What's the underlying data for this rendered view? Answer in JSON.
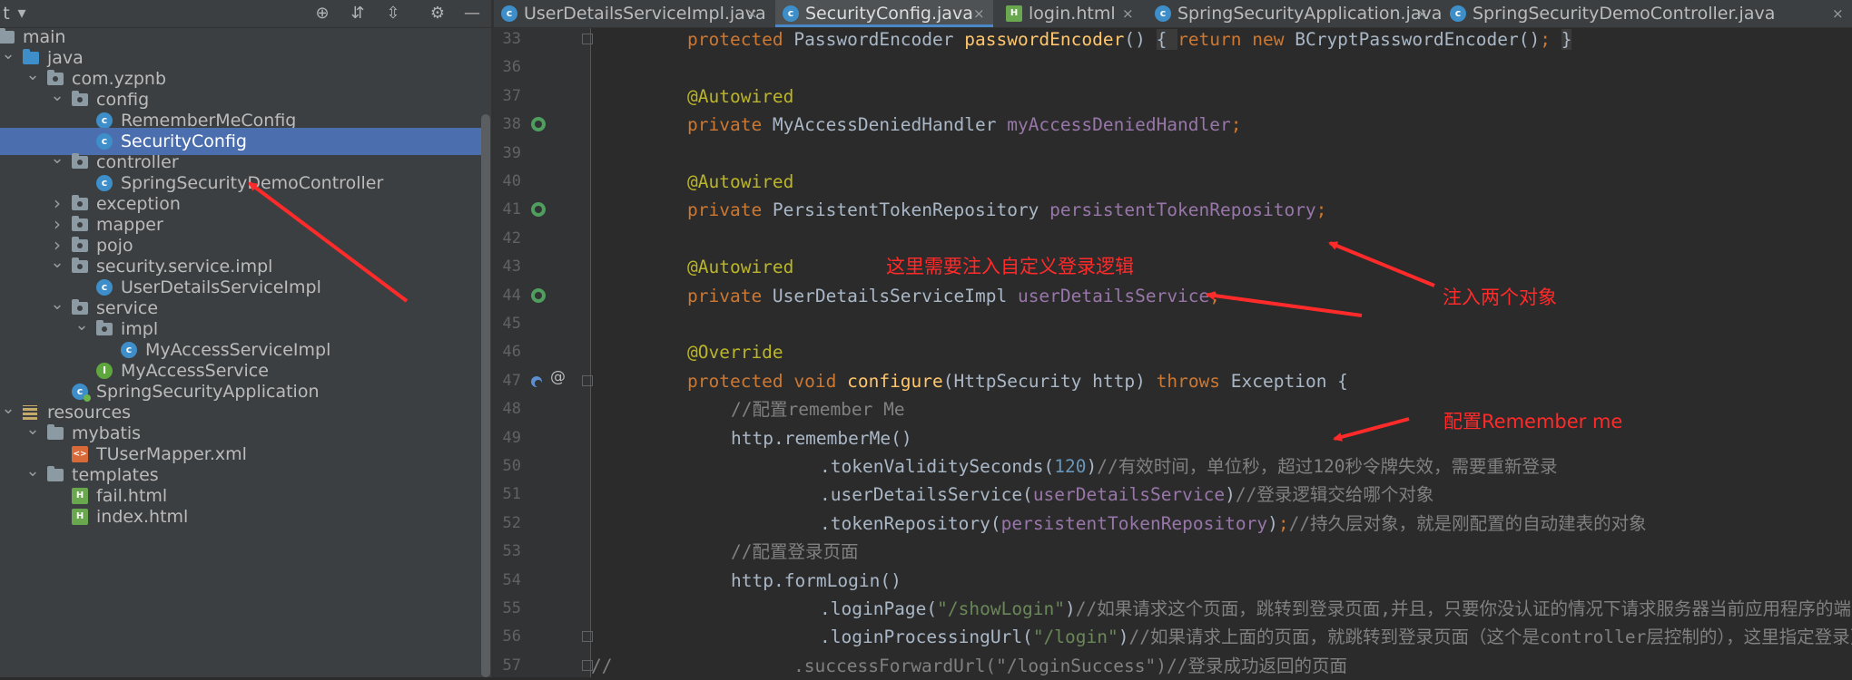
{
  "sidebar": {
    "items": [
      {
        "label": "main",
        "arrow": "open",
        "icon": "folder"
      },
      {
        "label": "java",
        "arrow": "open",
        "icon": "folder-blue"
      },
      {
        "label": "com.yzpnb",
        "arrow": "open",
        "icon": "package"
      },
      {
        "label": "config",
        "arrow": "open",
        "icon": "package"
      },
      {
        "label": "RememberMeConfig",
        "arrow": "",
        "icon": "class"
      },
      {
        "label": "SecurityConfig",
        "arrow": "",
        "icon": "class",
        "selected": true
      },
      {
        "label": "controller",
        "arrow": "open",
        "icon": "package"
      },
      {
        "label": "SpringSecurityDemoController",
        "arrow": "",
        "icon": "class"
      },
      {
        "label": "exception",
        "arrow": "closed",
        "icon": "package"
      },
      {
        "label": "mapper",
        "arrow": "closed",
        "icon": "package"
      },
      {
        "label": "pojo",
        "arrow": "closed",
        "icon": "package"
      },
      {
        "label": "security.service.impl",
        "arrow": "open",
        "icon": "package"
      },
      {
        "label": "UserDetailsServiceImpl",
        "arrow": "",
        "icon": "class"
      },
      {
        "label": "service",
        "arrow": "open",
        "icon": "package"
      },
      {
        "label": "impl",
        "arrow": "open",
        "icon": "package"
      },
      {
        "label": "MyAccessServiceImpl",
        "arrow": "",
        "icon": "class"
      },
      {
        "label": "MyAccessService",
        "arrow": "",
        "icon": "interface"
      },
      {
        "label": "SpringSecurityApplication",
        "arrow": "",
        "icon": "app-class"
      },
      {
        "label": "resources",
        "arrow": "open",
        "icon": "resources-folder"
      },
      {
        "label": "mybatis",
        "arrow": "open",
        "icon": "folder"
      },
      {
        "label": "TUserMapper.xml",
        "arrow": "",
        "icon": "xml-file"
      },
      {
        "label": "templates",
        "arrow": "open",
        "icon": "folder"
      },
      {
        "label": "fail.html",
        "arrow": "",
        "icon": "html-file"
      },
      {
        "label": "index.html",
        "arrow": "",
        "icon": "html-file"
      }
    ],
    "toolbar_glyphs": {
      "target": "⊕",
      "expand": "⇵",
      "collapse": "⇳",
      "settings": "⚙",
      "hide": "—",
      "dropdown": "▾",
      "t": "t"
    }
  },
  "tabs": [
    {
      "label": "UserDetailsServiceImpl.java",
      "icon": "C",
      "kind": "class"
    },
    {
      "label": "SecurityConfig.java",
      "icon": "C",
      "kind": "class",
      "active": true
    },
    {
      "label": "login.html",
      "icon": "H",
      "kind": "html"
    },
    {
      "label": "SpringSecurityApplication.java",
      "icon": "C",
      "kind": "class"
    },
    {
      "label": "SpringSecurityDemoController.java",
      "icon": "C",
      "kind": "class"
    }
  ],
  "tab_close_glyph": "×",
  "editor": {
    "line_numbers": [
      "33",
      "36",
      "37",
      "38",
      "39",
      "40",
      "41",
      "42",
      "43",
      "44",
      "45",
      "46",
      "47",
      "48",
      "49",
      "50",
      "51",
      "52",
      "53",
      "54",
      "55",
      "56",
      "57"
    ],
    "lines": [
      {
        "indent": 1,
        "tokens": [
          [
            "kw",
            "protected "
          ],
          [
            "ty",
            "PasswordEncoder "
          ],
          [
            "fn",
            "passwordEncoder"
          ],
          [
            "ty",
            "() "
          ],
          [
            "fbox",
            "{ "
          ],
          [
            "kw",
            "return new "
          ],
          [
            "ty",
            "BCryptPasswordEncoder()"
          ],
          [
            "kw",
            "; "
          ],
          [
            "fbox",
            "}"
          ]
        ]
      },
      {
        "indent": 1,
        "tokens": []
      },
      {
        "indent": 1,
        "tokens": [
          [
            "an",
            "@Autowired"
          ]
        ]
      },
      {
        "indent": 1,
        "tokens": [
          [
            "kw",
            "private "
          ],
          [
            "ty",
            "MyAccessDeniedHandler "
          ],
          [
            "fld",
            "myAccessDeniedHandler"
          ],
          [
            "kw",
            ";"
          ]
        ]
      },
      {
        "indent": 1,
        "tokens": []
      },
      {
        "indent": 1,
        "tokens": [
          [
            "an",
            "@Autowired"
          ]
        ]
      },
      {
        "indent": 1,
        "tokens": [
          [
            "kw",
            "private "
          ],
          [
            "ty",
            "PersistentTokenRepository "
          ],
          [
            "fld",
            "persistentTokenRepository"
          ],
          [
            "kw",
            ";"
          ]
        ]
      },
      {
        "indent": 1,
        "tokens": []
      },
      {
        "indent": 1,
        "tokens": [
          [
            "an",
            "@Autowired"
          ]
        ]
      },
      {
        "indent": 1,
        "tokens": [
          [
            "kw",
            "private "
          ],
          [
            "ty",
            "UserDetailsServiceImpl "
          ],
          [
            "fld",
            "userDetailsService"
          ],
          [
            "kw",
            ";"
          ]
        ]
      },
      {
        "indent": 1,
        "tokens": []
      },
      {
        "indent": 1,
        "tokens": [
          [
            "an",
            "@Override"
          ]
        ]
      },
      {
        "indent": 1,
        "tokens": [
          [
            "kw",
            "protected void "
          ],
          [
            "fn",
            "configure"
          ],
          [
            "ty",
            "(HttpSecurity http) "
          ],
          [
            "kw",
            "throws "
          ],
          [
            "ty",
            "Exception {"
          ]
        ]
      },
      {
        "indent": 2,
        "tokens": [
          [
            "cmt",
            "//配置remember Me"
          ]
        ]
      },
      {
        "indent": 2,
        "tokens": [
          [
            "ty",
            "http.rememberMe()"
          ]
        ]
      },
      {
        "indent": 4,
        "tokens": [
          [
            "ty",
            ".tokenValiditySeconds("
          ],
          [
            "num",
            "120"
          ],
          [
            "ty",
            ")"
          ],
          [
            "cmt",
            "//有效时间，单位秒，超过120秒令牌失效，需要重新登录"
          ]
        ]
      },
      {
        "indent": 4,
        "tokens": [
          [
            "ty",
            ".userDetailsService("
          ],
          [
            "fld",
            "userDetailsService"
          ],
          [
            "ty",
            ")"
          ],
          [
            "cmt",
            "//登录逻辑交给哪个对象"
          ]
        ]
      },
      {
        "indent": 4,
        "tokens": [
          [
            "ty",
            ".tokenRepository("
          ],
          [
            "fld",
            "persistentTokenRepository"
          ],
          [
            "ty",
            ")"
          ],
          [
            "kw",
            ";"
          ],
          [
            "cmt",
            "//持久层对象，就是刚配置的自动建表的对象"
          ]
        ]
      },
      {
        "indent": 2,
        "tokens": [
          [
            "cmt",
            "//配置登录页面"
          ]
        ]
      },
      {
        "indent": 2,
        "tokens": [
          [
            "ty",
            "http.formLogin()"
          ]
        ]
      },
      {
        "indent": 4,
        "tokens": [
          [
            "ty",
            ".loginPage("
          ],
          [
            "str",
            "\"/showLogin\""
          ],
          [
            "ty",
            ")"
          ],
          [
            "cmt",
            "//如果请求这个页面，跳转到登录页面,并且，只要你没认证的情况下请求服务器当前应用程序的端口，都会"
          ]
        ]
      },
      {
        "indent": 4,
        "tokens": [
          [
            "ty",
            ".loginProcessingUrl("
          ],
          [
            "str",
            "\"/login\""
          ],
          [
            "ty",
            ")"
          ],
          [
            "cmt",
            "//如果请求上面的页面，就跳转到登录页面（这个是controller层控制的），这里指定登录页面，"
          ]
        ]
      },
      {
        "indent": 0,
        "prefix": "//",
        "tokens": [
          [
            "cmt",
            "                 .successForwardUrl(\"/loginSuccess\")//登录成功返回的页面"
          ]
        ]
      }
    ]
  },
  "annotations": {
    "inject_custom_login": "这里需要注入自定义登录逻辑",
    "inject_two_objects": "注入两个对象",
    "configure_remember": "配置Remember me"
  },
  "colors": {
    "annotation": "#ff2a2a",
    "selection": "#4b6eaf",
    "editor_bg": "#2b2b2b",
    "sidebar_bg": "#3c3f41"
  }
}
